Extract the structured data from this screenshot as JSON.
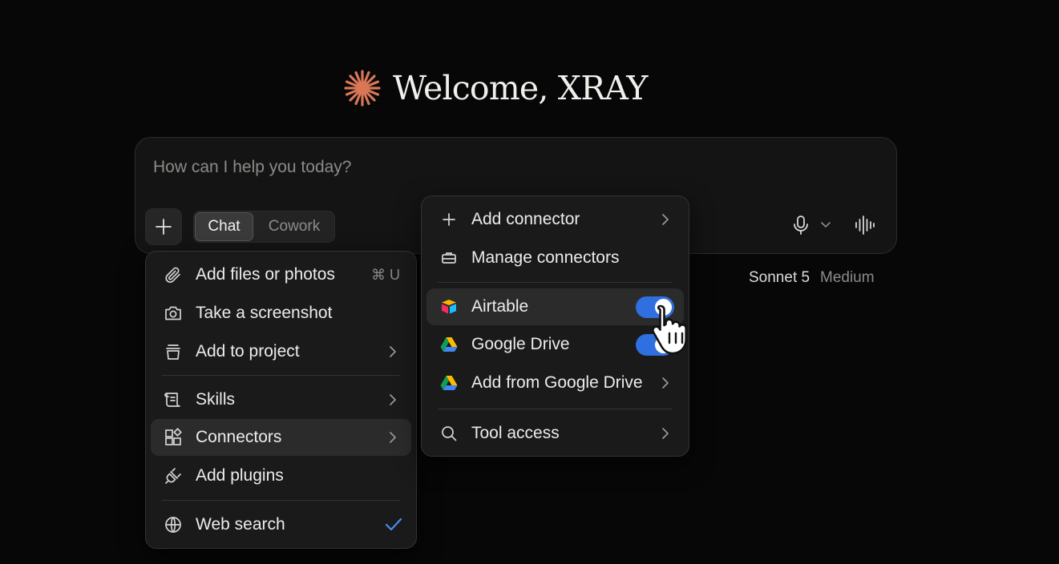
{
  "welcome": {
    "title": "Welcome, XRAY",
    "logo_icon": "starburst-icon",
    "logo_color": "#d97757"
  },
  "composer": {
    "placeholder": "How can I help you today?",
    "modes": [
      "Chat",
      "Cowork"
    ],
    "active_mode": "Chat"
  },
  "model": {
    "name": "Sonnet 5",
    "effort": "Medium"
  },
  "attach_menu": {
    "items": [
      {
        "label": "Add files or photos",
        "shortcut": "⌘ U",
        "icon": "paperclip-icon"
      },
      {
        "label": "Take a screenshot",
        "icon": "camera-icon"
      },
      {
        "label": "Add to project",
        "icon": "project-icon"
      },
      {
        "label": "Skills",
        "icon": "skills-icon"
      },
      {
        "label": "Connectors",
        "icon": "connectors-icon"
      },
      {
        "label": "Add plugins",
        "icon": "plug-icon"
      },
      {
        "label": "Web search",
        "icon": "globe-icon",
        "checked": true
      }
    ]
  },
  "connectors_menu": {
    "items": [
      {
        "label": "Add connector",
        "icon": "plus-icon"
      },
      {
        "label": "Manage connectors",
        "icon": "toolbox-icon"
      },
      {
        "label": "Airtable",
        "icon": "airtable-icon",
        "enabled": true
      },
      {
        "label": "Google Drive",
        "icon": "google-drive-icon",
        "enabled": true
      },
      {
        "label": "Add from Google Drive",
        "icon": "google-drive-icon"
      },
      {
        "label": "Tool access",
        "icon": "search-icon"
      }
    ]
  },
  "colors": {
    "accent": "#2f6fe0",
    "check": "#4a8cf0",
    "background": "#070707"
  }
}
